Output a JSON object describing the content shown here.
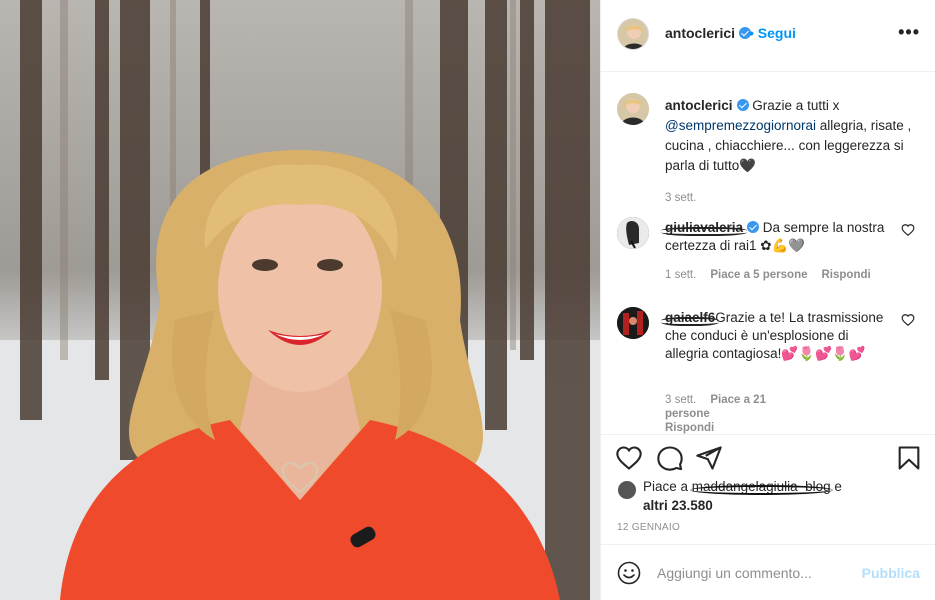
{
  "post": {
    "username": "antoclerici",
    "follow_label": "Segui",
    "more_label": "•••"
  },
  "caption": {
    "username": "antoclerici",
    "text_before": "Grazie a tutti x ",
    "mention": "@sempremezzogiornorai",
    "text_after": " allegria, risate , cucina , chiacchiere... con leggerezza si parla di tutto🖤",
    "time": "3 sett."
  },
  "comments": [
    {
      "username": "giuliavaleria",
      "text": " Da sempre la nostra certezza di rai1 ✿💪🩶",
      "time": "1 sett.",
      "likes": "Piace a 5 persone",
      "reply": "Rispondi"
    },
    {
      "username": "gaiaelf6",
      "text": "Grazie a te! La trasmissione che conduci è un'esplosione di allegria contagiosa!💕🌷💕🌷💕",
      "time": "3 sett.",
      "likes": "Piace a 21 persone",
      "reply": "Rispondi"
    }
  ],
  "likes": {
    "prefix": "Piace a",
    "user": "maddangelagiulia_blog",
    "suffix": " e",
    "others": "altri 23.580"
  },
  "date": "12 GENNAIO",
  "add_comment": {
    "placeholder": "Aggiungi un commento...",
    "publish": "Pubblica"
  },
  "colors": {
    "accent": "#0095f6",
    "publish_disabled": "#b2dffc",
    "sweater": "#ef4a2c"
  },
  "icons": [
    "heart-icon",
    "comment-icon",
    "share-icon",
    "bookmark-icon",
    "emoji-icon",
    "verified-icon",
    "more-icon"
  ]
}
